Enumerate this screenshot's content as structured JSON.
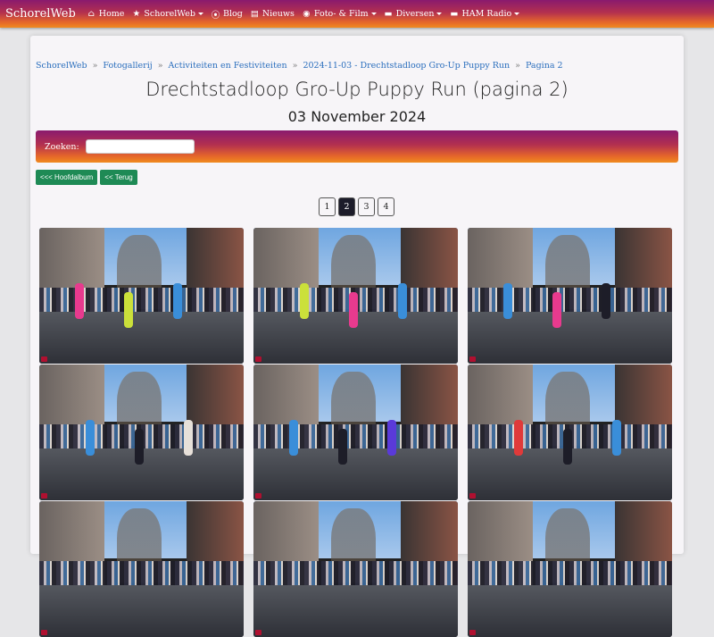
{
  "navbar": {
    "brand": "SchorelWeb",
    "items": [
      {
        "label": "Home",
        "icon": "home-icon"
      },
      {
        "label": "SchorelWeb",
        "icon": "star-icon",
        "dropdown": true
      },
      {
        "label": "Blog",
        "icon": "rss-icon"
      },
      {
        "label": "Nieuws",
        "icon": "newspaper-icon"
      },
      {
        "label": "Foto- & Film",
        "icon": "camera-icon",
        "dropdown": true
      },
      {
        "label": "Diversen",
        "icon": "folder-icon",
        "dropdown": true
      },
      {
        "label": "HAM Radio",
        "icon": "folder-icon",
        "dropdown": true
      }
    ]
  },
  "breadcrumb": [
    "SchorelWeb",
    "Fotogallerij",
    "Activiteiten en Festiviteiten",
    "2024-11-03 - Drechtstadloop Gro-Up Puppy Run",
    "Pagina 2"
  ],
  "page": {
    "title": "Drechtstadloop Gro-Up Puppy Run (pagina 2)",
    "date": "03 November 2024"
  },
  "search": {
    "label": "Zoeken:",
    "value": "",
    "placeholder": ""
  },
  "buttons": {
    "main_album": "<<< Hoofdalbum",
    "back": "<< Terug"
  },
  "pagination": {
    "pages": [
      "1",
      "2",
      "3",
      "4"
    ],
    "current": "2"
  },
  "colors": {
    "accent_start": "#8a1a6e",
    "accent_end": "#f08a1e",
    "button_green": "#1e8a55"
  },
  "photos": [
    {
      "runners": [
        "#e83a8e",
        "#cbe03a",
        "#3a8ed9"
      ]
    },
    {
      "runners": [
        "#cbe03a",
        "#e83a8e",
        "#3a8ed9"
      ]
    },
    {
      "runners": [
        "#3a8ed9",
        "#e83a8e",
        "#1d1d28"
      ]
    },
    {
      "runners": [
        "#3a8ed9",
        "#1d1d28",
        "#e7e0d9"
      ]
    },
    {
      "runners": [
        "#3a8ed9",
        "#1d1d28",
        "#5a3ad9"
      ]
    },
    {
      "runners": [
        "#e03a3a",
        "#1d1d28",
        "#3a8ed9"
      ]
    },
    {
      "runners": []
    },
    {
      "runners": []
    },
    {
      "runners": []
    }
  ]
}
